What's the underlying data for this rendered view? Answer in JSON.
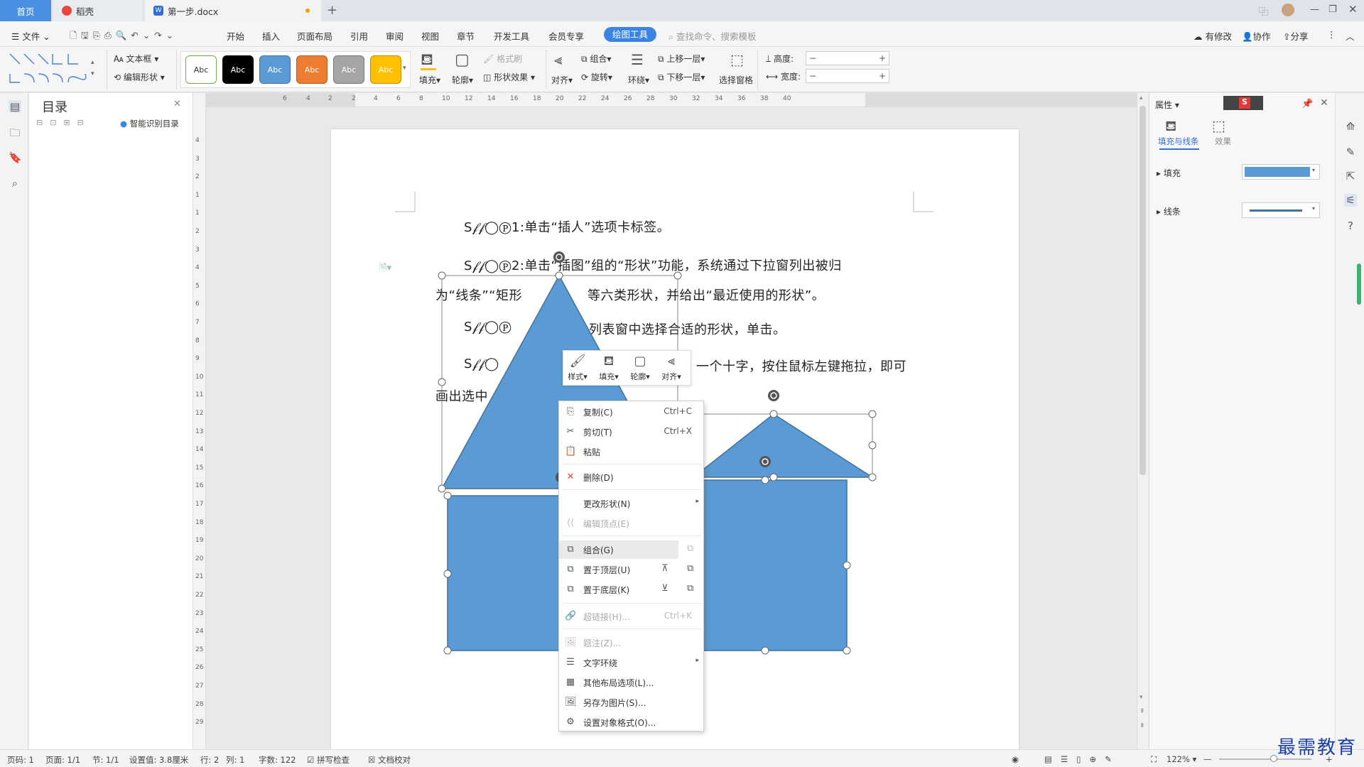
{
  "titlebar": {
    "tab_home": "首页",
    "tab_docer": "稻壳",
    "tab_doc": "第一步.docx",
    "new_tab": "+"
  },
  "menubar": {
    "file": "文件",
    "items": [
      "开始",
      "插入",
      "页面布局",
      "引用",
      "审阅",
      "视图",
      "章节",
      "开发工具",
      "会员专享"
    ],
    "active": "绘图工具",
    "search_placeholder": "查找命令、搜索模板",
    "modified": "有修改",
    "collab": "协作",
    "share": "分享"
  },
  "ribbon": {
    "textbox": "文本框",
    "edit_shape": "编辑形状",
    "styles": [
      {
        "label": "Abc",
        "bg": "#ffffff",
        "fg": "#333333",
        "border": "#70ad47"
      },
      {
        "label": "Abc",
        "bg": "#000000",
        "fg": "#ffffff",
        "border": "#000000"
      },
      {
        "label": "Abc",
        "bg": "#5b9bd5",
        "fg": "#ffffff",
        "border": "#41719c"
      },
      {
        "label": "Abc",
        "bg": "#ed7d31",
        "fg": "#ffffff",
        "border": "#ae5a21"
      },
      {
        "label": "Abc",
        "bg": "#a5a5a5",
        "fg": "#ffffff",
        "border": "#787878"
      },
      {
        "label": "Abc",
        "bg": "#ffc000",
        "fg": "#ffffff",
        "border": "#bc8c00"
      }
    ],
    "fill": "填充",
    "outline": "轮廓",
    "format_painter": "格式刷",
    "shape_effects": "形状效果",
    "align": "对齐",
    "group": "组合",
    "rotate": "旋转",
    "wrap": "环绕",
    "bring_forward": "上移一层",
    "send_backward": "下移一层",
    "selection_pane": "选择窗格",
    "height_label": "高度:",
    "width_label": "宽度:"
  },
  "nav": {
    "title": "目录",
    "smart": "智能识别目录"
  },
  "ruler": {
    "h_ticks": [
      "6",
      "4",
      "2",
      "2",
      "4",
      "6",
      "8",
      "10",
      "12",
      "14",
      "16",
      "18",
      "20",
      "22",
      "24",
      "26",
      "28",
      "30",
      "32",
      "34",
      "36",
      "38",
      "40"
    ],
    "v_ticks": [
      "4",
      "3",
      "2",
      "1",
      "1",
      "2",
      "3",
      "4",
      "5",
      "6",
      "7",
      "8",
      "9",
      "10",
      "11",
      "12",
      "13",
      "14",
      "15",
      "16",
      "17",
      "18",
      "19",
      "20",
      "21",
      "22",
      "23",
      "24",
      "25",
      "26",
      "27",
      "28",
      "29"
    ]
  },
  "document": {
    "lines": [
      "S𝒻𝒻◯Ⓟ1:单击“插人”选项卡标签。",
      "S𝒻𝒻◯Ⓟ2:单击“插图”组的“形状”功能，系统通过下拉窗列出被归",
      "为“线条”“矩形",
      "等六类形状，并给出“最近使用的形状”。",
      "S𝒻𝒻◯Ⓟ",
      "列表窗中选择合适的形状，单击。",
      "S𝒻𝒻◯",
      "一个十字，按住鼠标左键拖拉，即可",
      "画出选中"
    ],
    "shape_color": "#5b9bd5",
    "shape_border": "#41719c"
  },
  "minitoolbar": {
    "items": [
      "样式",
      "填充",
      "轮廓",
      "对齐"
    ]
  },
  "context_menu": {
    "items": [
      {
        "label": "复制(C)",
        "shortcut": "Ctrl+C",
        "icon": "copy-icon",
        "disabled": false
      },
      {
        "label": "剪切(T)",
        "shortcut": "Ctrl+X",
        "icon": "scissors-icon",
        "disabled": false
      },
      {
        "label": "粘贴",
        "shortcut": "",
        "icon": "paste-icon",
        "disabled": false
      },
      {
        "label": "删除(D)",
        "shortcut": "",
        "icon": "delete-icon",
        "disabled": false
      },
      {
        "label": "更改形状(N)",
        "shortcut": "",
        "icon": "",
        "disabled": false
      },
      {
        "label": "编辑顶点(E)",
        "shortcut": "",
        "icon": "edit-points-icon",
        "disabled": true
      },
      {
        "label": "组合(G)",
        "shortcut": "",
        "icon": "group-icon",
        "disabled": false
      },
      {
        "label": "置于顶层(U)",
        "shortcut": "",
        "icon": "bring-front-icon",
        "disabled": false
      },
      {
        "label": "置于底层(K)",
        "shortcut": "",
        "icon": "send-back-icon",
        "disabled": false
      },
      {
        "label": "超链接(H)...",
        "shortcut": "Ctrl+K",
        "icon": "link-icon",
        "disabled": true
      },
      {
        "label": "题注(Z)...",
        "shortcut": "",
        "icon": "caption-icon",
        "disabled": true
      },
      {
        "label": "文字环绕",
        "shortcut": "",
        "icon": "wrap-icon",
        "disabled": false
      },
      {
        "label": "其他布局选项(L)...",
        "shortcut": "",
        "icon": "layout-icon",
        "disabled": false
      },
      {
        "label": "另存为图片(S)...",
        "shortcut": "",
        "icon": "save-image-icon",
        "disabled": false
      },
      {
        "label": "设置对象格式(O)...",
        "shortcut": "",
        "icon": "format-object-icon",
        "disabled": false
      }
    ]
  },
  "right_panel": {
    "title": "属性",
    "tab_fill_line": "填充与线条",
    "tab_effects": "效果",
    "fill": "填充",
    "line": "线条",
    "fill_color": "#5b9bd5",
    "line_color": "#41719c"
  },
  "statusbar": {
    "page_num": "页码: 1",
    "pages": "页面: 1/1",
    "section": "节: 1/1",
    "setting": "设置值: 3.8厘米",
    "row": "行: 2",
    "col": "列: 1",
    "words": "字数: 122",
    "spell": "拼写检查",
    "proof": "文档校对",
    "zoom": "122%"
  },
  "watermark": "最需教育"
}
